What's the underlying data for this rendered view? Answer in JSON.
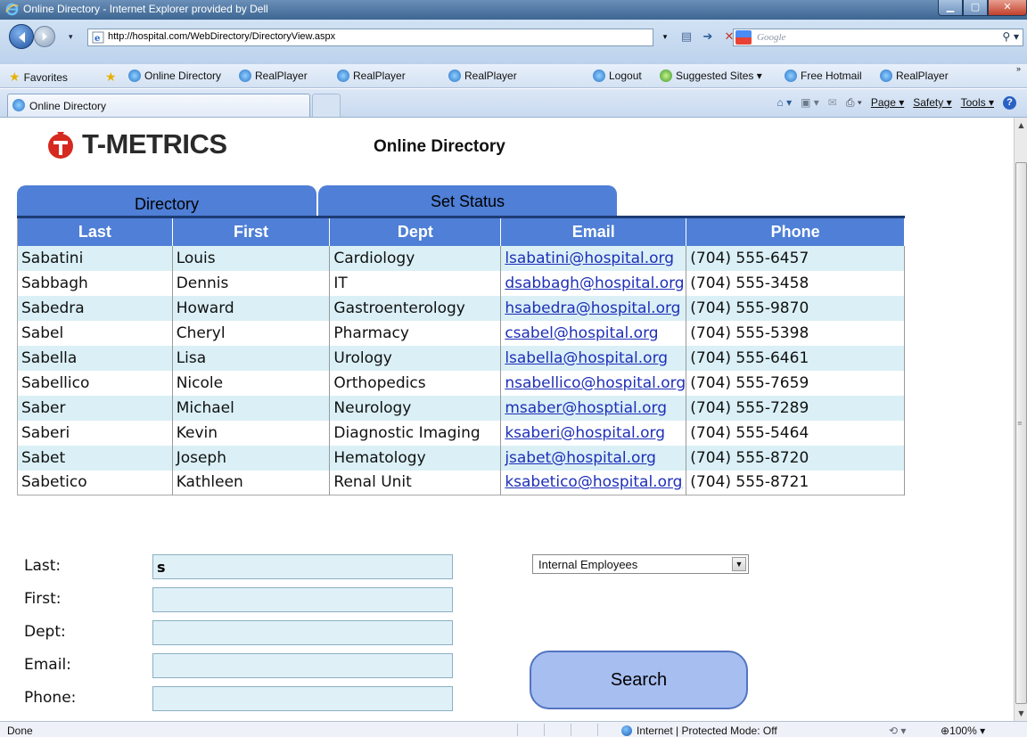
{
  "window": {
    "title": "Online Directory - Internet Explorer provided by Dell"
  },
  "browser": {
    "url": "http://hospital.com/WebDirectory/DirectoryView.aspx",
    "search_placeholder": "Google",
    "tab_title": "Online Directory",
    "favorites_label": "Favorites",
    "favorites": [
      "Online Directory",
      "RealPlayer",
      "RealPlayer",
      "RealPlayer",
      "Logout",
      "Suggested Sites ▾",
      "Free Hotmail",
      "RealPlayer"
    ],
    "commands": [
      "Page ▾",
      "Safety ▾",
      "Tools ▾"
    ],
    "status_text": "Done",
    "zone_text": "Internet | Protected Mode: Off",
    "zoom": "100%"
  },
  "app": {
    "logo_text": "T-METRICS",
    "title": "Online Directory",
    "tabs": [
      "Directory",
      "Set Status"
    ],
    "columns": [
      "Last",
      "First",
      "Dept",
      "Email",
      "Phone"
    ],
    "rows": [
      {
        "last": "Sabatini",
        "first": "Louis",
        "dept": "Cardiology",
        "email": "lsabatini@hospital.org",
        "phone": "(704) 555-6457"
      },
      {
        "last": "Sabbagh",
        "first": "Dennis",
        "dept": "IT",
        "email": "dsabbagh@hospital.org",
        "phone": "(704) 555-3458"
      },
      {
        "last": "Sabedra",
        "first": "Howard",
        "dept": "Gastroenterology",
        "email": "hsabedra@hospital.org",
        "phone": "(704) 555-9870"
      },
      {
        "last": "Sabel",
        "first": "Cheryl",
        "dept": "Pharmacy",
        "email": "csabel@hospital.org",
        "phone": "(704) 555-5398"
      },
      {
        "last": "Sabella",
        "first": "Lisa",
        "dept": "Urology",
        "email": "lsabella@hospital.org",
        "phone": "(704) 555-6461"
      },
      {
        "last": "Sabellico",
        "first": "Nicole",
        "dept": "Orthopedics",
        "email": "nsabellico@hospital.org",
        "phone": "(704) 555-7659"
      },
      {
        "last": "Saber",
        "first": "Michael",
        "dept": "Neurology",
        "email": "msaber@hosptial.org",
        "phone": "(704) 555-7289"
      },
      {
        "last": "Saberi",
        "first": "Kevin",
        "dept": "Diagnostic Imaging",
        "email": "ksaberi@hospital.org",
        "phone": "(704) 555-5464"
      },
      {
        "last": "Sabet",
        "first": "Joseph",
        "dept": "Hematology",
        "email": "jsabet@hospital.org",
        "phone": "(704) 555-8720"
      },
      {
        "last": "Sabetico",
        "first": "Kathleen",
        "dept": "Renal Unit",
        "email": "ksabetico@hospital.org",
        "phone": "(704) 555-8721"
      }
    ],
    "form": {
      "fields": [
        {
          "label": "Last:",
          "value": "s"
        },
        {
          "label": "First:",
          "value": ""
        },
        {
          "label": "Dept:",
          "value": ""
        },
        {
          "label": "Email:",
          "value": ""
        },
        {
          "label": "Phone:",
          "value": ""
        }
      ],
      "employee_filter": "Internal Employees",
      "search_button": "Search"
    }
  },
  "colors": {
    "accent_blue": "#4f7fd6",
    "row_alt": "#daf0f6",
    "input_bg": "#dff1f7",
    "link": "#1e2fb8",
    "search_button": "#a7bef0"
  }
}
